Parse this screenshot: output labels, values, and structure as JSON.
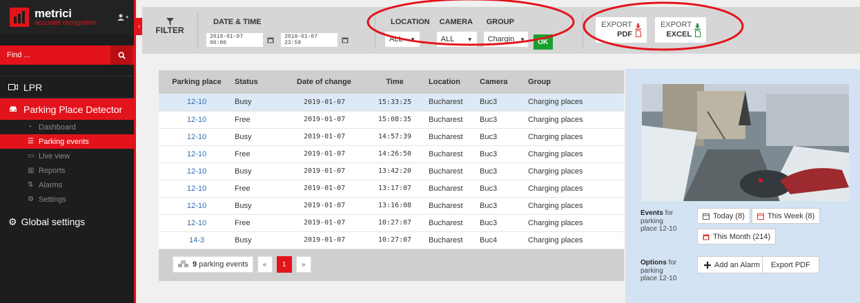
{
  "brand": {
    "name": "metrici",
    "tagline": "accurate recognition"
  },
  "colors": {
    "accent": "#e3131b",
    "sidebar_bg": "#1d1d1d",
    "ok_green": "#19a02f",
    "link_blue": "#2b6cb0",
    "selected_row": "#dde9f7",
    "panel_blue": "#d4e3f3"
  },
  "search": {
    "placeholder": "Find ..."
  },
  "nav": {
    "lpr": "LPR",
    "ppd": "Parking Place Detector",
    "sub": [
      "Dashboard",
      "Parking events",
      "Live view",
      "Reports",
      "Alarms",
      "Settings"
    ],
    "global": "Global settings"
  },
  "toolbar": {
    "filter": "FILTER",
    "datetime_label": "DATE & TIME",
    "date_from": "2019-01-07 00:00",
    "date_to": "2019-01-07 23:59",
    "location_label": "LOCATION",
    "location_value": "ALL",
    "camera_label": "CAMERA",
    "camera_value": "ALL",
    "group_label": "GROUP",
    "group_value": "Chargin",
    "ok": "OK",
    "export_label": "EXPORT",
    "export_pdf": "PDF",
    "export_excel": "EXCEL"
  },
  "table": {
    "headers": [
      "Parking place",
      "Status",
      "Date of change",
      "Time",
      "Location",
      "Camera",
      "Group"
    ],
    "rows": [
      [
        "12-10",
        "Busy",
        "2019-01-07",
        "15:33:25",
        "Bucharest",
        "Buc3",
        "Charging places"
      ],
      [
        "12-10",
        "Free",
        "2019-01-07",
        "15:08:35",
        "Bucharest",
        "Buc3",
        "Charging places"
      ],
      [
        "12-10",
        "Busy",
        "2019-01-07",
        "14:57:39",
        "Bucharest",
        "Buc3",
        "Charging places"
      ],
      [
        "12-10",
        "Free",
        "2019-01-07",
        "14:26:50",
        "Bucharest",
        "Buc3",
        "Charging places"
      ],
      [
        "12-10",
        "Busy",
        "2019-01-07",
        "13:42:20",
        "Bucharest",
        "Buc3",
        "Charging places"
      ],
      [
        "12-10",
        "Free",
        "2019-01-07",
        "13:17:07",
        "Bucharest",
        "Buc3",
        "Charging places"
      ],
      [
        "12-10",
        "Busy",
        "2019-01-07",
        "13:16:08",
        "Bucharest",
        "Buc3",
        "Charging places"
      ],
      [
        "12-10",
        "Free",
        "2019-01-07",
        "10:27:07",
        "Bucharest",
        "Buc3",
        "Charging places"
      ],
      [
        "14-3",
        "Busy",
        "2019-01-07",
        "10:27:07",
        "Bucharest",
        "Buc4",
        "Charging places"
      ]
    ]
  },
  "pager": {
    "count": "9",
    "count_label": "parking events",
    "first": "«",
    "current": "1",
    "last": "»"
  },
  "side": {
    "events_bold": "Events",
    "events_rest": " for parking place 12-10",
    "today": "Today (8)",
    "week": "This Week (8)",
    "month": "This Month (214)",
    "options_bold": "Options",
    "options_rest": " for parking place 12-10",
    "add_alarm": "Add an Alarm",
    "export_pdf": "Export PDF"
  }
}
